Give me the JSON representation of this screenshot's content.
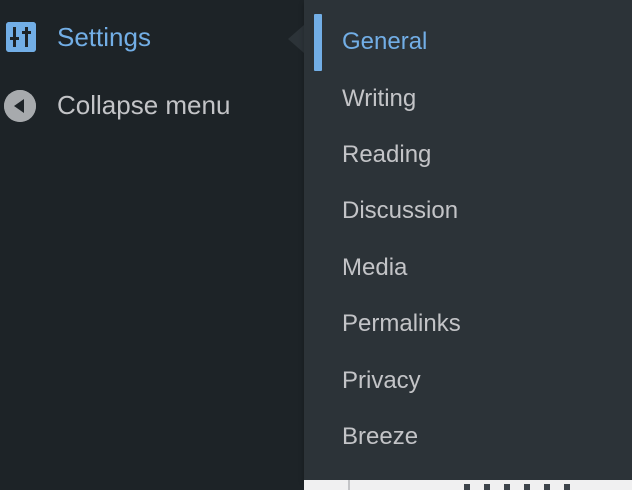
{
  "admin_menu": {
    "settings": {
      "label": "Settings",
      "icon": "settings-sliders-icon",
      "state": "open"
    },
    "collapse": {
      "label": "Collapse menu",
      "icon": "collapse-arrow-icon"
    }
  },
  "submenu": {
    "current": "General",
    "items": [
      {
        "label": "General"
      },
      {
        "label": "Writing"
      },
      {
        "label": "Reading"
      },
      {
        "label": "Discussion"
      },
      {
        "label": "Media"
      },
      {
        "label": "Permalinks"
      },
      {
        "label": "Privacy"
      },
      {
        "label": "Breeze"
      }
    ]
  },
  "colors": {
    "menu_bg": "#1d2327",
    "submenu_bg": "#2c3338",
    "accent": "#72aee6",
    "text": "#c3c4c7"
  }
}
